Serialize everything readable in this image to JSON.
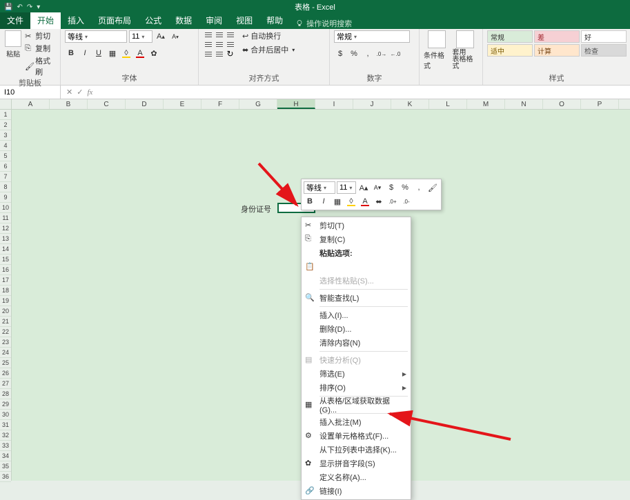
{
  "app": {
    "title": "表格  -  Excel"
  },
  "tabs": {
    "file": "文件",
    "home": "开始",
    "insert": "插入",
    "layout": "页面布局",
    "formulas": "公式",
    "data": "数据",
    "review": "审阅",
    "view": "视图",
    "help": "帮助",
    "search": "操作说明搜索"
  },
  "ribbon": {
    "clipboard": {
      "label": "剪贴板",
      "paste": "粘贴",
      "cut": "剪切",
      "copy": "复制",
      "format_painter": "格式刷"
    },
    "font": {
      "label": "字体",
      "name": "等线",
      "size": "11",
      "increase": "A",
      "decrease": "A"
    },
    "alignment": {
      "label": "对齐方式",
      "wrap": "自动换行",
      "merge": "合并后居中"
    },
    "number": {
      "label": "数字",
      "format": "常规",
      "percent": "%",
      "comma": ",",
      "inc": ".0",
      "dec": ".00"
    },
    "styles": {
      "label": "样式",
      "conditional": "条件格式",
      "as_table": "套用\n表格格式",
      "cells": {
        "normal": "常规",
        "bad": "差",
        "good": "好",
        "neutral": "适中",
        "calc": "计算",
        "check": "检查"
      }
    }
  },
  "namebox": "I10",
  "cell": {
    "label": "身份证号"
  },
  "columns": [
    "A",
    "B",
    "C",
    "D",
    "E",
    "F",
    "G",
    "H",
    "I",
    "J",
    "K",
    "L",
    "M",
    "N",
    "O",
    "P"
  ],
  "selected_col_index": 7,
  "minibar": {
    "font": "等线",
    "size": "11"
  },
  "context_menu": {
    "cut": "剪切(T)",
    "copy": "复制(C)",
    "paste_options": "粘贴选项:",
    "paste_special": "选择性粘贴(S)...",
    "smart_lookup": "智能查找(L)",
    "insert": "插入(I)...",
    "delete": "删除(D)...",
    "clear": "清除内容(N)",
    "quick_analysis": "快速分析(Q)",
    "filter": "筛选(E)",
    "sort": "排序(O)",
    "get_data": "从表格/区域获取数据(G)...",
    "insert_comment": "插入批注(M)",
    "format_cells": "设置单元格格式(F)...",
    "pick_list": "从下拉列表中选择(K)...",
    "phonetic": "显示拼音字段(S)",
    "define_name": "定义名称(A)...",
    "link": "链接(I)"
  }
}
